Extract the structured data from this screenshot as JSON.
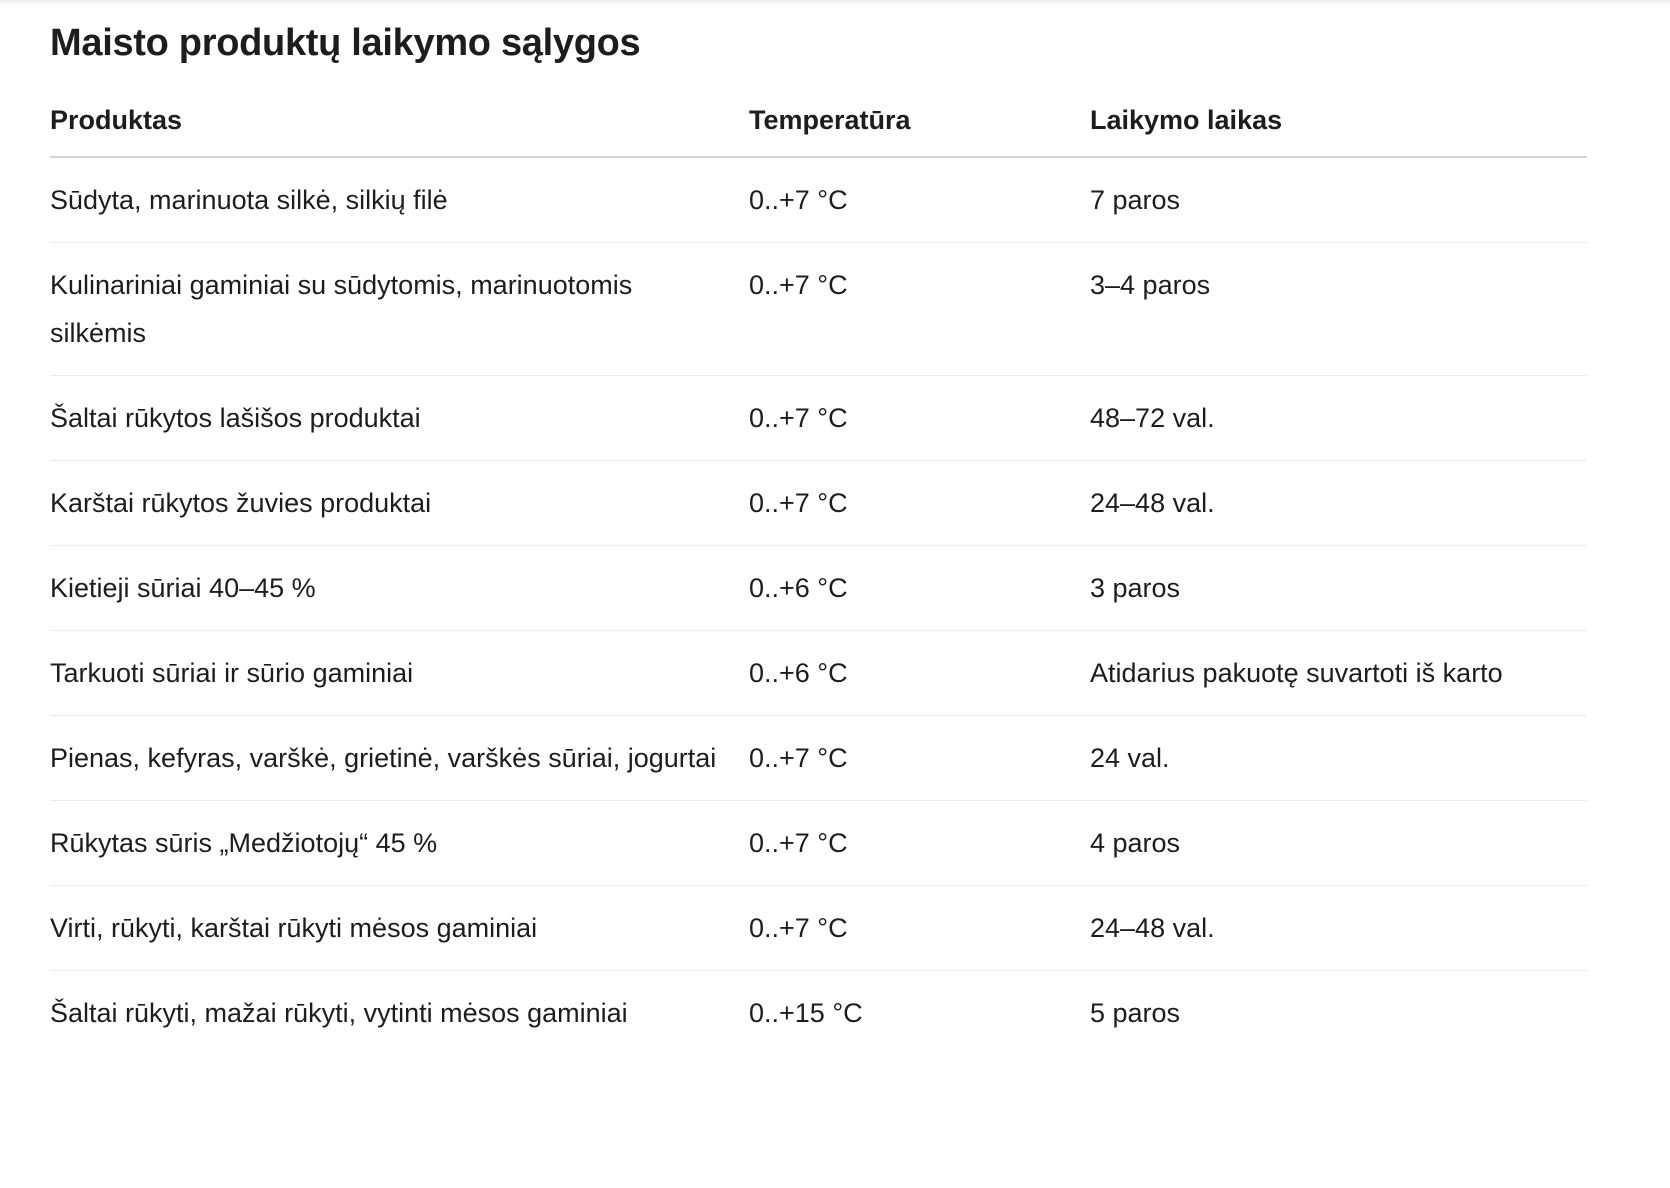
{
  "page": {
    "title": "Maisto produktų laikymo sąlygos"
  },
  "table": {
    "headers": [
      "Produktas",
      "Temperatūra",
      "Laikymo laikas"
    ],
    "rows": [
      [
        "Sūdyta, marinuota silkė, silkių filė",
        "0..+7 °C",
        "7 paros"
      ],
      [
        "Kulinariniai gaminiai su sūdytomis, marinuotomis silkėmis",
        "0..+7 °C",
        "3–4 paros"
      ],
      [
        "Šaltai rūkytos lašišos produktai",
        "0..+7 °C",
        "48–72 val."
      ],
      [
        "Karštai rūkytos žuvies produktai",
        "0..+7 °C",
        "24–48 val."
      ],
      [
        "Kietieji sūriai 40–45 %",
        "0..+6 °C",
        "3 paros"
      ],
      [
        "Tarkuoti sūriai ir sūrio gaminiai",
        "0..+6 °C",
        "Atidarius pakuotę suvartoti iš karto"
      ],
      [
        "Pienas, kefyras, varškė, grietinė, varškės sūriai, jogurtai",
        "0..+7 °C",
        "24 val."
      ],
      [
        "Rūkytas sūris „Medžiotojų“ 45 %",
        "0..+7 °C",
        "4 paros"
      ],
      [
        "Virti, rūkyti, karštai rūkyti mėsos gaminiai",
        "0..+7 °C",
        "24–48 val."
      ],
      [
        "Šaltai rūkyti, mažai rūkyti, vytinti mėsos gaminiai",
        "0..+15 °C",
        "5 paros"
      ]
    ]
  }
}
